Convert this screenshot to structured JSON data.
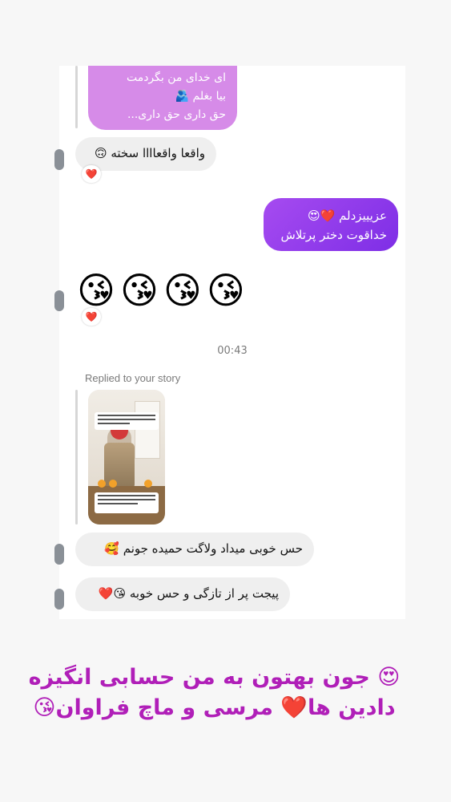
{
  "messages": {
    "quote_line1": "ای خدای من بگردمت",
    "quote_line2": "بیا بغلم 🫂",
    "quote_line3": "حق داری حق داری...",
    "quote_more": "more",
    "incoming_1": "واقعا واقعاااا سخته 🙃",
    "outgoing_1_line1": "عزیییزدلم ❤️😍",
    "outgoing_1_line2": "خداقوت دختر پرتلاش",
    "emoji_message": "😘😘😘😘",
    "timestamp": "00:43",
    "replied_label": "Replied to your story",
    "incoming_2": "حس خوبی میداد ولاگت حمیده جونم 🥰",
    "incoming_3": "پیجت پر از تازگی و حس خوبه 😘❤️"
  },
  "reactions": {
    "heart": "❤️"
  },
  "caption": {
    "line1": "😍 جون بهتون به من حسابی انگیزه",
    "line2": "دادین ها❤️ مرسی و ماچ فراوان😘"
  },
  "colors": {
    "outgoing_gradient_start": "#a64bf0",
    "outgoing_gradient_end": "#7e2ee6",
    "quote_bubble": "#d68be8",
    "incoming_bubble": "#efefef",
    "caption_text": "#b01fb8"
  }
}
